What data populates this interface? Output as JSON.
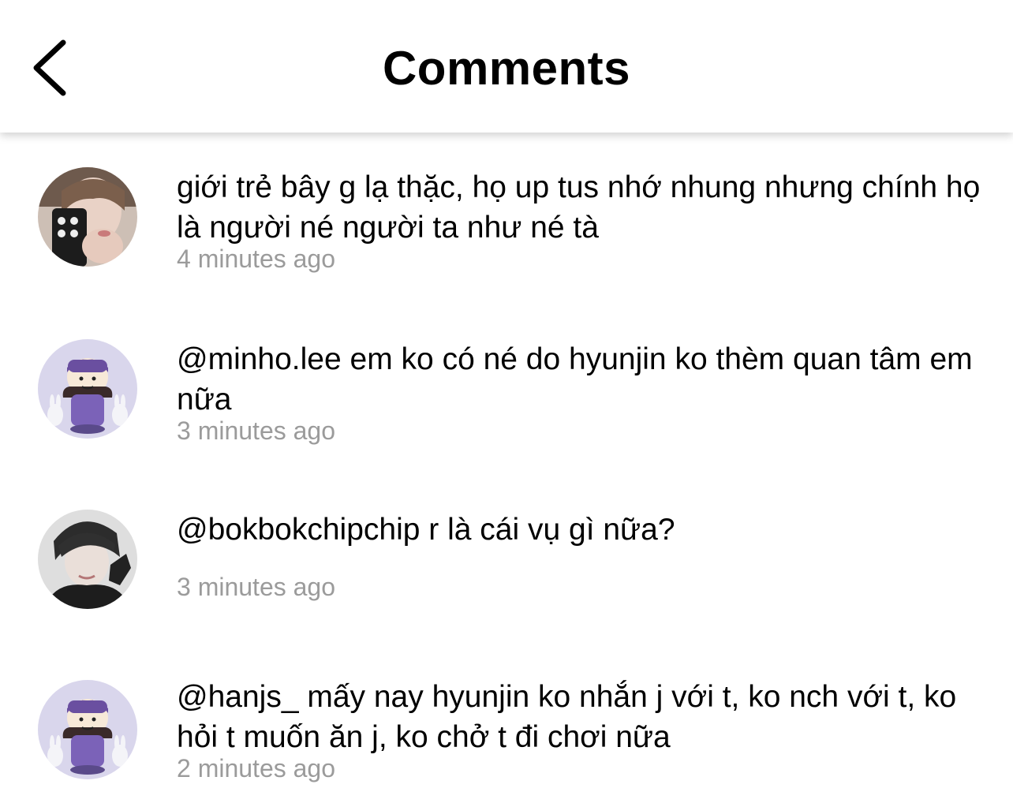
{
  "header": {
    "title": "Comments",
    "back_icon": "chevron-left-icon"
  },
  "comments": [
    {
      "avatar": "avatar-boy-phone",
      "text": "giới trẻ bây g lạ thặc, họ up tus nhớ nhung nhưng chính họ là người né người ta như né tà",
      "time": "4 minutes ago"
    },
    {
      "avatar": "avatar-cartoon-rabbits",
      "text": "@minho.lee em ko có né do hyunjin ko thèm quan tâm em nữa",
      "time": "3 minutes ago"
    },
    {
      "avatar": "avatar-boy-glove",
      "text": "@bokbokchipchip r là cái vụ gì nữa?",
      "time": "3 minutes ago"
    },
    {
      "avatar": "avatar-cartoon-rabbits",
      "text": "@hanjs_ mấy nay hyunjin ko nhắn j với t, ko nch với t, ko hỏi t muốn ăn j, ko chở t đi chơi nữa",
      "time": "2 minutes ago"
    }
  ],
  "colors": {
    "timestamp": "#9b9b9b",
    "text": "#000000",
    "background": "#ffffff"
  }
}
